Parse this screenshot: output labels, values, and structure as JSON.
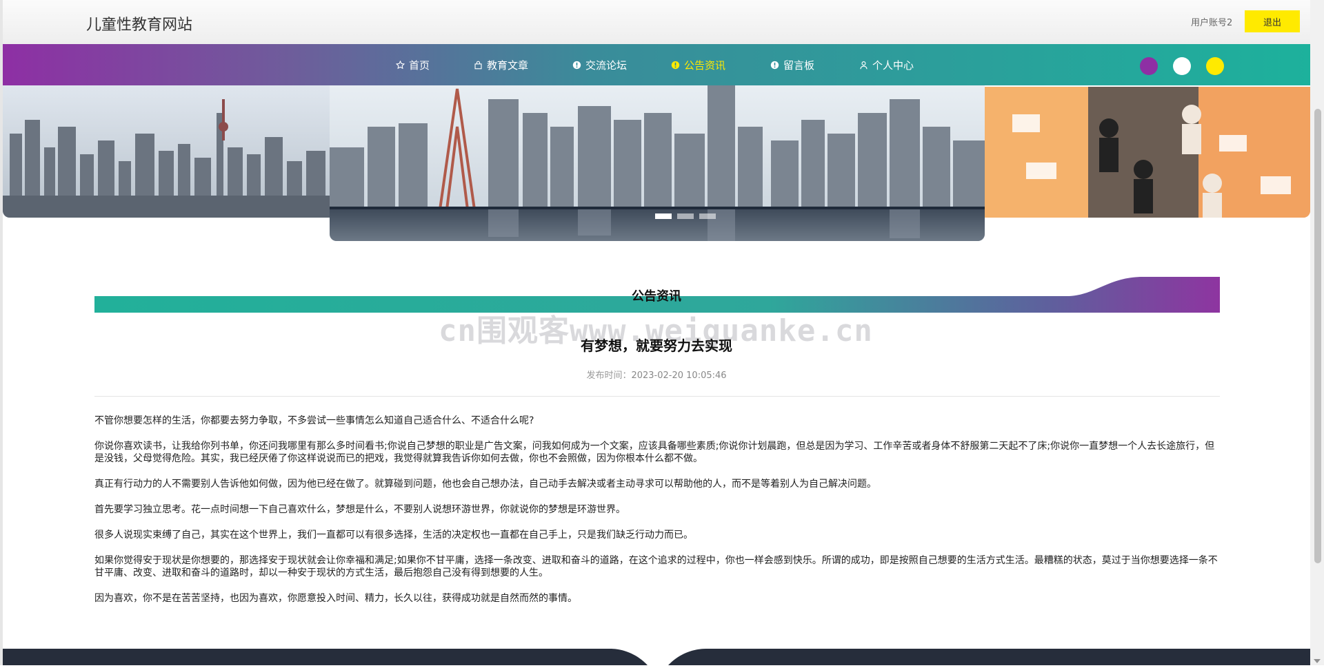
{
  "header": {
    "site_title": "儿童性教育网站",
    "user_label": "用户账号2",
    "logout_label": "退出"
  },
  "nav": {
    "items": [
      {
        "label": "首页",
        "icon": "star-icon"
      },
      {
        "label": "教育文章",
        "icon": "bag-icon"
      },
      {
        "label": "交流论坛",
        "icon": "info-circle-icon"
      },
      {
        "label": "公告资讯",
        "icon": "info-circle-icon",
        "active": true
      },
      {
        "label": "留言板",
        "icon": "info-circle-icon"
      },
      {
        "label": "个人中心",
        "icon": "user-icon"
      }
    ],
    "theme_dots": [
      "#8e2fa4",
      "#ffffff",
      "#ffea00"
    ],
    "active_color": "#ffea00"
  },
  "banner": {
    "slide_count": 3,
    "active_index": 0
  },
  "section": {
    "title": "公告资讯"
  },
  "watermark": "cn围观客www.weiguanke.cn",
  "article": {
    "title": "有梦想，就要努力去实现",
    "meta_label": "发布时间：",
    "meta_time": "2023-02-20 10:05:46",
    "paragraphs": [
      "不管你想要怎样的生活，你都要去努力争取，不多尝试一些事情怎么知道自己适合什么、不适合什么呢?",
      "你说你喜欢读书，让我给你列书单，你还问我哪里有那么多时间看书;你说自己梦想的职业是广告文案，问我如何成为一个文案，应该具备哪些素质;你说你计划晨跑，但总是因为学习、工作辛苦或者身体不舒服第二天起不了床;你说你一直梦想一个人去长途旅行，但是没钱，父母觉得危险。其实，我已经厌倦了你这样说说而已的把戏，我觉得就算我告诉你如何去做，你也不会照做，因为你根本什么都不做。",
      "真正有行动力的人不需要别人告诉他如何做，因为他已经在做了。就算碰到问题，他也会自己想办法，自己动手去解决或者主动寻求可以帮助他的人，而不是等着别人为自己解决问题。",
      "首先要学习独立思考。花一点时间想一下自己喜欢什么，梦想是什么，不要别人说想环游世界，你就说你的梦想是环游世界。",
      "很多人说现实束缚了自己，其实在这个世界上，我们一直都可以有很多选择，生活的决定权也一直都在自己手上，只是我们缺乏行动力而已。",
      "如果你觉得安于现状是你想要的，那选择安于现状就会让你幸福和满足;如果你不甘平庸，选择一条改变、进取和奋斗的道路，在这个追求的过程中，你也一样会感到快乐。所谓的成功，即是按照自己想要的生活方式生活。最糟糕的状态，莫过于当你想要选择一条不甘平庸、改变、进取和奋斗的道路时，却以一种安于现状的方式生活，最后抱怨自己没有得到想要的人生。",
      "因为喜欢，你不是在苦苦坚持，也因为喜欢，你愿意投入时间、精力，长久以往，获得成功就是自然而然的事情。"
    ]
  }
}
